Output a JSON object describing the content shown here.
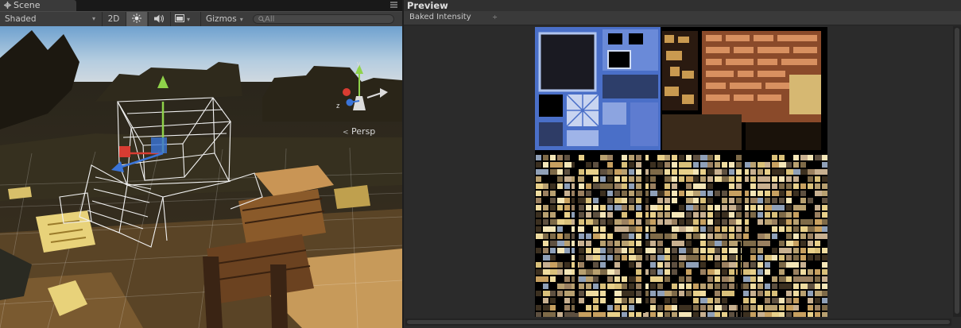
{
  "scene": {
    "tab_label": "Scene",
    "shading_mode": "Shaded",
    "mode_2d": "2D",
    "gizmos_label": "Gizmos",
    "search_placeholder": "All",
    "projection_label": "Persp",
    "axis_y": "y",
    "axis_z": "z"
  },
  "preview": {
    "title": "Preview",
    "mode": "Baked Intensity",
    "dropdown_arrow": "÷"
  },
  "icons": [
    "scene-tab-icon",
    "panel-menu-icon",
    "light-toggle-icon",
    "audio-toggle-icon",
    "effects-toggle-icon",
    "search-icon",
    "scene-gizmo-icon"
  ],
  "colors": {
    "accent_yellow": "#f0d060",
    "gizmo_y": "#8fd24a",
    "gizmo_z": "#3a74d8",
    "gizmo_x": "#d83c32"
  }
}
